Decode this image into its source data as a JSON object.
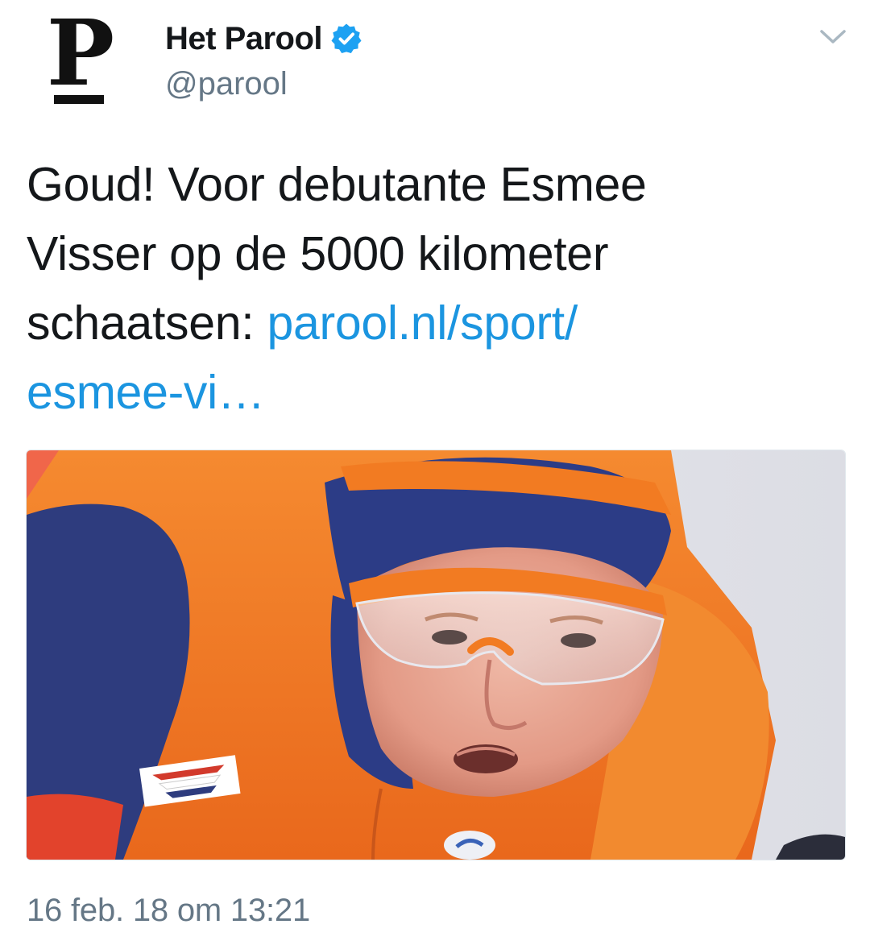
{
  "account": {
    "avatar_letter": "P",
    "name": "Het Parool",
    "handle": "@parool",
    "verified": true
  },
  "tweet": {
    "text_plain": "Goud! Voor debutante Esmee Visser op de 5000 kilometer schaatsen: ",
    "link_text": "parool.nl/sport/esmee-vi…",
    "line_1": "Goud! Voor debutante Esmee",
    "line_2": "Visser op de 5000 kilometer",
    "line_3_text": "schaatsen: ",
    "line_3_link": "parool.nl/sport/",
    "line_4_link": "esmee-vi…",
    "timestamp": "16 feb. 18 om 13:21"
  },
  "icons": {
    "verified": "verified-badge-icon",
    "chevron": "chevron-down-icon"
  },
  "colors": {
    "text": "#14171a",
    "secondary": "#657786",
    "link": "#1b95e0",
    "verified": "#1da1f2",
    "suit_orange": "#f47a20",
    "suit_navy": "#2a3a7c"
  }
}
